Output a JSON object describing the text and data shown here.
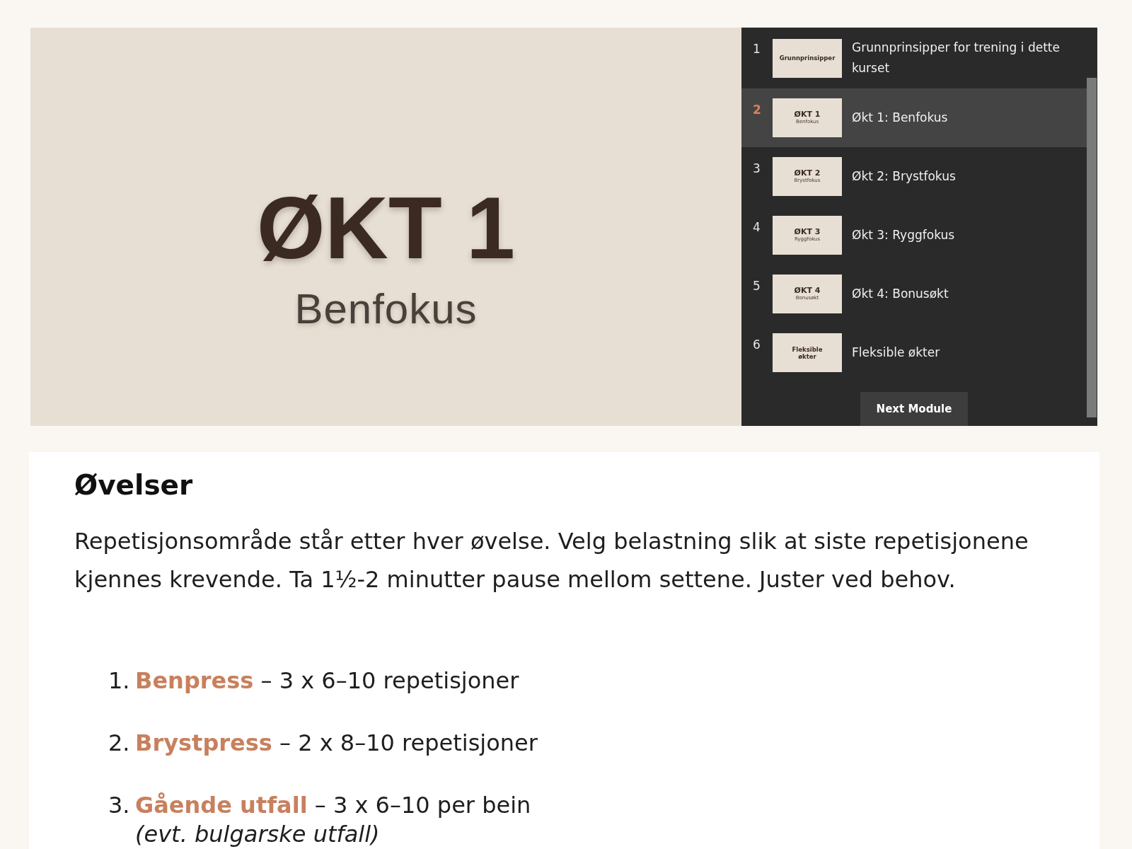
{
  "slide": {
    "title": "ØKT 1",
    "subtitle": "Benfokus"
  },
  "playlist": {
    "items": [
      {
        "number": "1",
        "title": "Grunnprinsipper for trening i dette kurset",
        "thumbnail": {
          "title": "Grunnprinsipper"
        },
        "selected": false
      },
      {
        "number": "2",
        "title": "Økt 1: Benfokus",
        "thumbnail": {
          "title": "ØKT 1",
          "subtitle": "Benfokus"
        },
        "selected": true
      },
      {
        "number": "3",
        "title": "Økt 2: Brystfokus",
        "thumbnail": {
          "title": "ØKT 2",
          "subtitle": "Brystfokus"
        },
        "selected": false
      },
      {
        "number": "4",
        "title": "Økt 3: Ryggfokus",
        "thumbnail": {
          "title": "ØKT 3",
          "subtitle": "Ryggfokus"
        },
        "selected": false
      },
      {
        "number": "5",
        "title": "Økt 4: Bonusøkt",
        "thumbnail": {
          "title": "ØKT 4",
          "subtitle": "Bonusøkt"
        },
        "selected": false
      },
      {
        "number": "6",
        "title": "Fleksible økter",
        "thumbnail": {
          "title": "Fleksible økter"
        },
        "selected": false
      }
    ],
    "next_button": "Next Module"
  },
  "content": {
    "heading": "Øvelser",
    "intro": "Repetisjonsområde står etter hver øvelse. Velg belastning slik at siste repetisjonene kjennes krevende. Ta 1½-2 minutter pause mellom settene. Juster ved behov.",
    "exercises": [
      {
        "number": "1.",
        "text": "**Benpress** – 3 x 6–10 repetisjoner"
      },
      {
        "number": "2.",
        "text": "**Brystpress** – 2 x 8–10 repetisjoner"
      },
      {
        "number": "3.",
        "text": "**Gående utfall** – 3 x 6–10 per bein",
        "note": "(evt. bulgarske utfall)"
      }
    ]
  }
}
